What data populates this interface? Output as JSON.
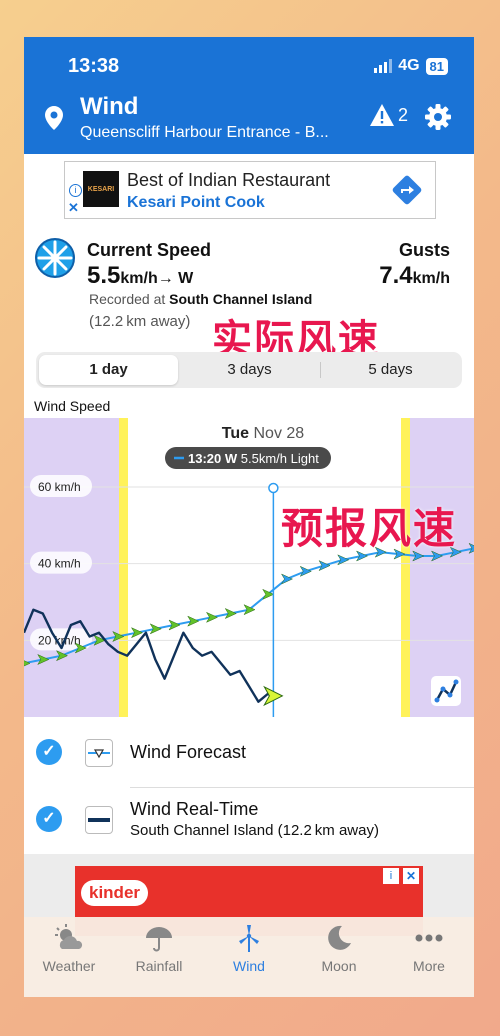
{
  "status_bar": {
    "time": "13:38",
    "network": "4G",
    "battery": "81"
  },
  "header": {
    "title": "Wind",
    "location": "Queenscliff Harbour Entrance - B...",
    "alert_count": "2"
  },
  "ad_top": {
    "title": "Best of Indian Restaurant",
    "subtitle": "Kesari Point Cook",
    "logo_text": "KESARI"
  },
  "current": {
    "speed_label": "Current Speed",
    "speed_value": "5.5",
    "speed_unit": "km/h",
    "direction": "→ W",
    "gusts_label": "Gusts",
    "gusts_value": "7.4",
    "gusts_unit": "km/h",
    "recorded_prefix": "Recorded at",
    "station": "South Channel Island",
    "distance": "(12.2 km away)"
  },
  "overlay_labels": {
    "actual": "实际风速",
    "forecast": "预报风速"
  },
  "range_tabs": [
    {
      "label": "1 day",
      "active": true
    },
    {
      "label": "3 days",
      "active": false
    },
    {
      "label": "5 days",
      "active": false
    }
  ],
  "chart_label": "Wind Speed",
  "chart_data": {
    "type": "line",
    "title": "",
    "day_label": "Tue",
    "date_label": "Nov 28",
    "cursor": {
      "time": "13:20",
      "direction": "W",
      "speed": "5.5km/h",
      "description": "Light"
    },
    "y_ticks": [
      "60 km/h",
      "40 km/h",
      "20 km/h"
    ],
    "ylim": [
      0,
      78
    ],
    "xlim": [
      0,
      24
    ],
    "cursor_hour": 13.3,
    "series": [
      {
        "name": "Wind Forecast",
        "x": [
          0,
          1,
          2,
          3,
          4,
          5,
          6,
          7,
          8,
          9,
          10,
          11,
          12,
          13,
          14,
          15,
          16,
          17,
          18,
          19,
          20,
          21,
          22,
          23,
          24
        ],
        "y": [
          14,
          15,
          16,
          18,
          20,
          21,
          22,
          23,
          24,
          25,
          26,
          27,
          28,
          32,
          36,
          38,
          39.5,
          41,
          42,
          43,
          42.5,
          42,
          42,
          43,
          44
        ]
      },
      {
        "name": "Wind Real-Time",
        "x": [
          0,
          0.5,
          1,
          1.5,
          2,
          2.5,
          3,
          3.5,
          4,
          4.5,
          5,
          5.5,
          6,
          6.5,
          7,
          7.5,
          8,
          8.5,
          9,
          9.5,
          10,
          10.5,
          11,
          11.5,
          12,
          12.5,
          13,
          13.3
        ],
        "y": [
          22,
          28,
          27,
          22,
          18,
          24,
          25,
          21,
          22,
          19,
          17,
          16,
          19,
          22,
          15,
          10,
          16,
          22,
          18,
          16,
          17,
          14,
          11,
          12,
          8,
          4,
          6,
          5.5
        ]
      }
    ]
  },
  "legend": [
    {
      "label": "Wind Forecast",
      "sub": ""
    },
    {
      "label": "Wind Real-Time",
      "sub": "South Channel Island (12.2 km away)"
    }
  ],
  "ad_bottom": {
    "brand": "kinder"
  },
  "tabbar": [
    {
      "label": "Weather",
      "icon": "weather-icon",
      "active": false
    },
    {
      "label": "Rainfall",
      "icon": "umbrella-icon",
      "active": false
    },
    {
      "label": "Wind",
      "icon": "wind-turbine-icon",
      "active": true
    },
    {
      "label": "Moon",
      "icon": "moon-icon",
      "active": false
    },
    {
      "label": "More",
      "icon": "more-dots-icon",
      "active": false
    }
  ],
  "colors": {
    "header": "#1a73d6",
    "forecast_line": "#2d9cf0",
    "actual_line": "#10325a",
    "night_band": "#ddd1f4",
    "twilight": "#fff25a",
    "accent": "#2d7fe0"
  }
}
